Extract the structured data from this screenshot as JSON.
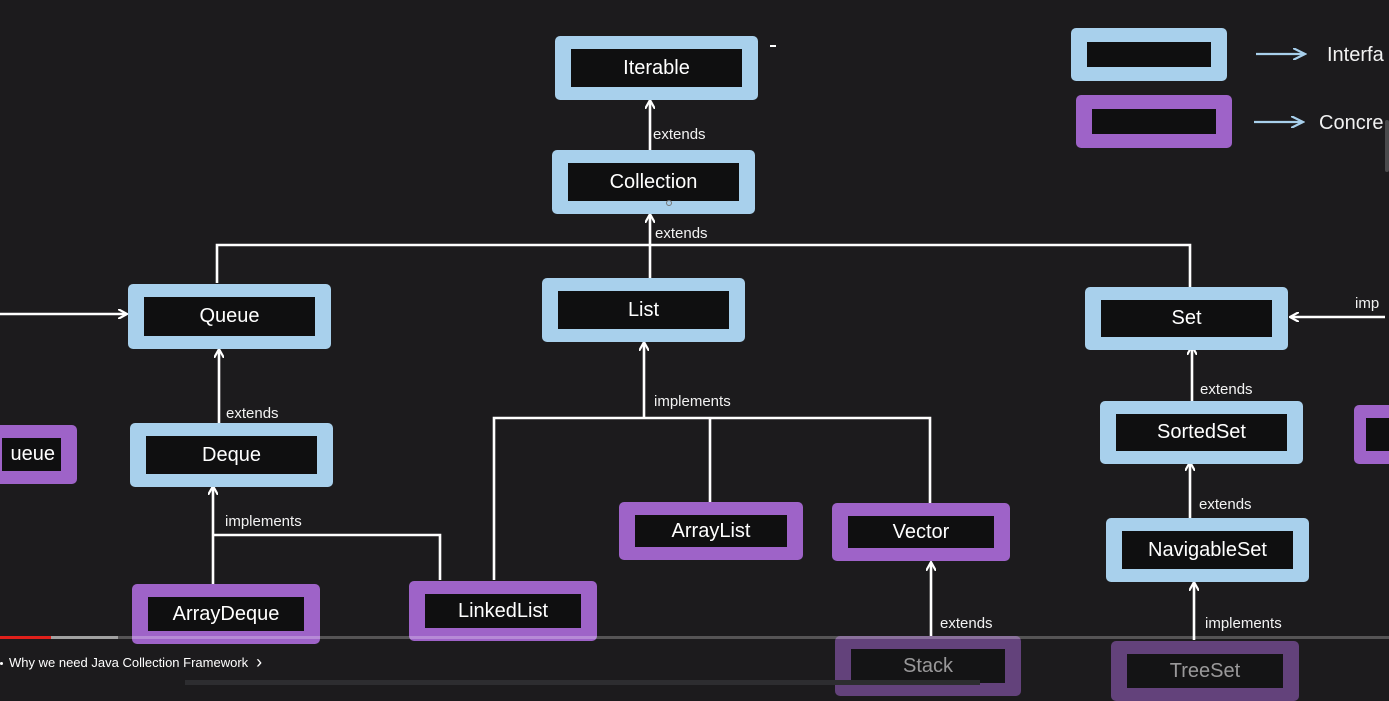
{
  "diagram": {
    "nodes": {
      "iterable": "Iterable",
      "collection": "Collection",
      "queue": "Queue",
      "list": "List",
      "set": "Set",
      "deque": "Deque",
      "sorted_set": "SortedSet",
      "navigable_set": "NavigableSet",
      "array_deque": "ArrayDeque",
      "linked_list": "LinkedList",
      "array_list": "ArrayList",
      "vector": "Vector",
      "stack": "Stack",
      "tree_set": "TreeSet",
      "priority_queue_partial": "ueue"
    },
    "edge_labels": {
      "collection_to_iterable": "extends",
      "children_to_collection": "extends",
      "deque_to_queue": "extends",
      "impl_to_list": "implements",
      "impl_to_deque": "implements",
      "sorted_to_set": "extends",
      "navigable_to_sorted": "extends",
      "stack_to_vector": "extends",
      "treeset_to_navigable": "implements",
      "right_edge_partial": "imp"
    }
  },
  "legend": {
    "interface_label": "Interfa",
    "concrete_label": "Concre",
    "interface_color": "#a8d0ec",
    "concrete_color": "#9e63c8"
  },
  "player": {
    "chapter_title": "Why we need Java Collection Framework",
    "chevron": "›",
    "progress_played": 0.037,
    "progress_buffered": 0.085,
    "progress_color": "#e0201b"
  }
}
